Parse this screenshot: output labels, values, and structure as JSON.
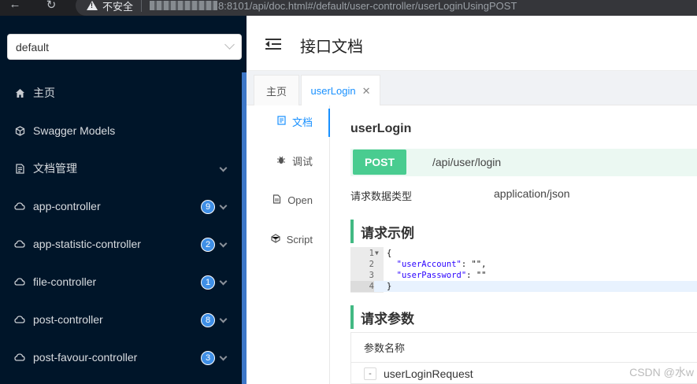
{
  "browser": {
    "back_icon": "arrow-left-icon",
    "reload_icon": "reload-icon",
    "security_label": "不安全",
    "url_visible": "8:8101/api/doc.html#/default/user-controller/userLoginUsingPOST"
  },
  "sidebar": {
    "group_select": "default",
    "items": [
      {
        "label": "主页",
        "icon": "home-icon"
      },
      {
        "label": "Swagger Models",
        "icon": "cube-icon"
      },
      {
        "label": "文档管理",
        "icon": "document-icon",
        "expandable": true
      },
      {
        "label": "app-controller",
        "icon": "cloud-icon",
        "count": "9"
      },
      {
        "label": "app-statistic-controller",
        "icon": "cloud-icon",
        "count": "2"
      },
      {
        "label": "file-controller",
        "icon": "cloud-icon",
        "count": "1"
      },
      {
        "label": "post-controller",
        "icon": "cloud-icon",
        "count": "8"
      },
      {
        "label": "post-favour-controller",
        "icon": "cloud-icon",
        "count": "3"
      }
    ]
  },
  "header": {
    "title": "接口文档"
  },
  "tabs": [
    {
      "label": "主页"
    },
    {
      "label": "userLogin",
      "active": true
    }
  ],
  "inner_nav": [
    {
      "label": "文档",
      "icon": "document-icon",
      "active": true
    },
    {
      "label": "调试",
      "icon": "bug-icon"
    },
    {
      "label": "Open",
      "icon": "file-icon"
    },
    {
      "label": "Script",
      "icon": "code-icon"
    }
  ],
  "operation": {
    "name": "userLogin",
    "method": "POST",
    "path": "/api/user/login",
    "request_type_label": "请求数据类型",
    "request_type_value": "application/json",
    "example_heading": "请求示例",
    "code_lines": [
      {
        "num": "1",
        "text": "{"
      },
      {
        "num": "2",
        "key": "\"userAccount\"",
        "rest": ": \"\","
      },
      {
        "num": "3",
        "key": "\"userPassword\"",
        "rest": ": \"\""
      },
      {
        "num": "4",
        "text": "}"
      }
    ],
    "params_heading": "请求参数",
    "params_header": "参数名称",
    "params_rows": [
      {
        "name": "userLoginRequest",
        "expander": "-"
      }
    ]
  },
  "colors": {
    "sidebar_bg": "#001529",
    "post_green": "#49cc90",
    "accent_blue": "#1890ff",
    "section_bar": "#42b983"
  },
  "watermark": "CSDN @水w"
}
